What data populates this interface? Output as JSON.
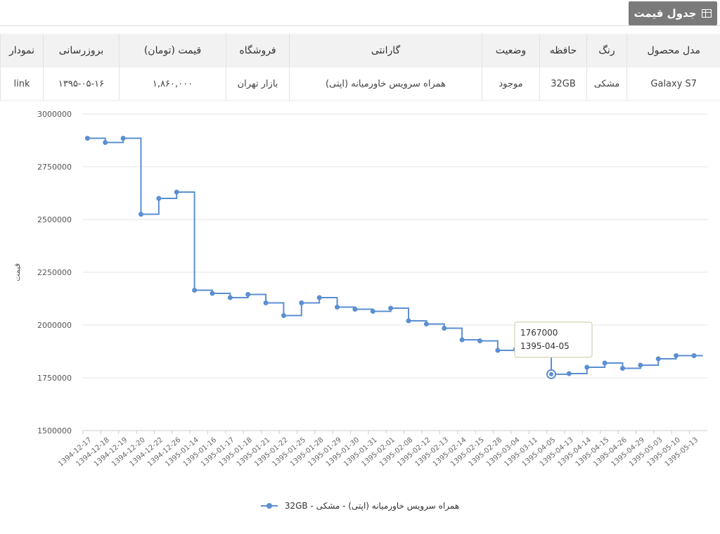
{
  "header": {
    "title": "جدول قیمت",
    "icon": "table-icon"
  },
  "table": {
    "columns": [
      "مدل محصول",
      "رنگ",
      "حافظه",
      "وضعیت",
      "گارانتی",
      "فروشگاه",
      "قیمت (تومان)",
      "بروزرسانی",
      "نمودار"
    ],
    "row": [
      "Galaxy S7",
      "مشکی",
      "32GB",
      "موجود",
      "همراه سرویس خاورمیانه (اپتی)",
      "بازار تهران",
      "۱,۸۶۰,۰۰۰",
      "۱۳۹۵-۰۵-۱۶",
      "link"
    ]
  },
  "chart_data": {
    "type": "line",
    "step": true,
    "ylabel": "قیمت",
    "ylim": [
      1500000,
      3000000
    ],
    "yticks": [
      1500000,
      1750000,
      2000000,
      2250000,
      2500000,
      2750000,
      3000000
    ],
    "ytick_labels": [
      "1500000",
      "1750000",
      "2000000",
      "2250000",
      "2500000",
      "2750000",
      "3000000"
    ],
    "categories": [
      "1394-12-17",
      "1394-12-18",
      "1394-12-19",
      "1394-12-20",
      "1394-12-22",
      "1394-12-26",
      "1395-01-14",
      "1395-01-16",
      "1395-01-17",
      "1395-01-18",
      "1395-01-21",
      "1395-01-22",
      "1395-01-25",
      "1395-01-28",
      "1395-01-29",
      "1395-01-30",
      "1395-01-31",
      "1395-02-01",
      "1395-02-08",
      "1395-02-12",
      "1395-02-13",
      "1395-02-14",
      "1395-02-15",
      "1395-02-28",
      "1395-03-04",
      "1395-03-11",
      "1395-04-05",
      "1395-04-13",
      "1395-04-14",
      "1395-04-15",
      "1395-04-26",
      "1395-04-29",
      "1395-05-03",
      "1395-05-10",
      "1395-05-13"
    ],
    "series": [
      {
        "name": "همراه سرویس خاورمیانه (اپتی) - مشکی - 32GB",
        "color": "#5b8fd0",
        "values": [
          2885000,
          2865000,
          2885000,
          2525000,
          2600000,
          2630000,
          2165000,
          2150000,
          2130000,
          2145000,
          2105000,
          2045000,
          2105000,
          2130000,
          2085000,
          2075000,
          2065000,
          2080000,
          2020000,
          2005000,
          1985000,
          1930000,
          1925000,
          1880000,
          1885000,
          1885000,
          1767000,
          1770000,
          1800000,
          1820000,
          1795000,
          1810000,
          1840000,
          1855000,
          1855000
        ]
      }
    ],
    "tooltip": {
      "value": "1767000",
      "date": "1395-04-05",
      "index": 26
    },
    "legend": "bottom-center",
    "grid": true
  }
}
